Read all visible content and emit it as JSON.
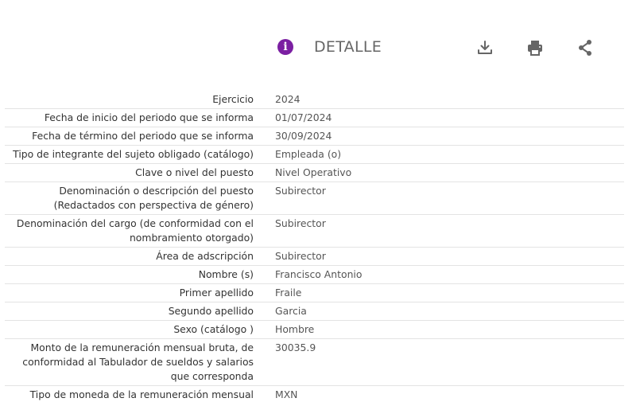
{
  "header": {
    "title": "DETALLE",
    "info_icon": "info-icon",
    "actions": [
      {
        "name": "download-icon"
      },
      {
        "name": "print-icon"
      },
      {
        "name": "share-icon"
      }
    ],
    "accent_color": "#7b1fa2",
    "icon_color": "#666666"
  },
  "rows": [
    {
      "label": "Ejercicio",
      "value": "2024"
    },
    {
      "label": "Fecha de inicio del periodo que se informa",
      "value": "01/07/2024"
    },
    {
      "label": "Fecha de término del periodo que se informa",
      "value": "30/09/2024"
    },
    {
      "label": "Tipo de integrante del sujeto obligado (catálogo)",
      "value": "Empleada (o)"
    },
    {
      "label": "Clave o nivel del puesto",
      "value": "Nivel Operativo"
    },
    {
      "label": "Denominación o descripción del puesto (Redactados con perspectiva de género)",
      "value": "Subirector"
    },
    {
      "label": "Denominación del cargo (de conformidad con el nombramiento otorgado)",
      "value": "Subirector"
    },
    {
      "label": "Área de adscripción",
      "value": "Subirector"
    },
    {
      "label": "Nombre (s)",
      "value": "Francisco Antonio"
    },
    {
      "label": "Primer apellido",
      "value": "Fraile"
    },
    {
      "label": "Segundo apellido",
      "value": "Garcia"
    },
    {
      "label": "Sexo (catálogo )",
      "value": "Hombre"
    },
    {
      "label": "Monto de la remuneración mensual bruta, de conformidad al Tabulador de sueldos y salarios que corresponda",
      "value": "30035.9"
    },
    {
      "label": "Tipo de moneda de la remuneración mensual",
      "value": "MXN"
    }
  ]
}
